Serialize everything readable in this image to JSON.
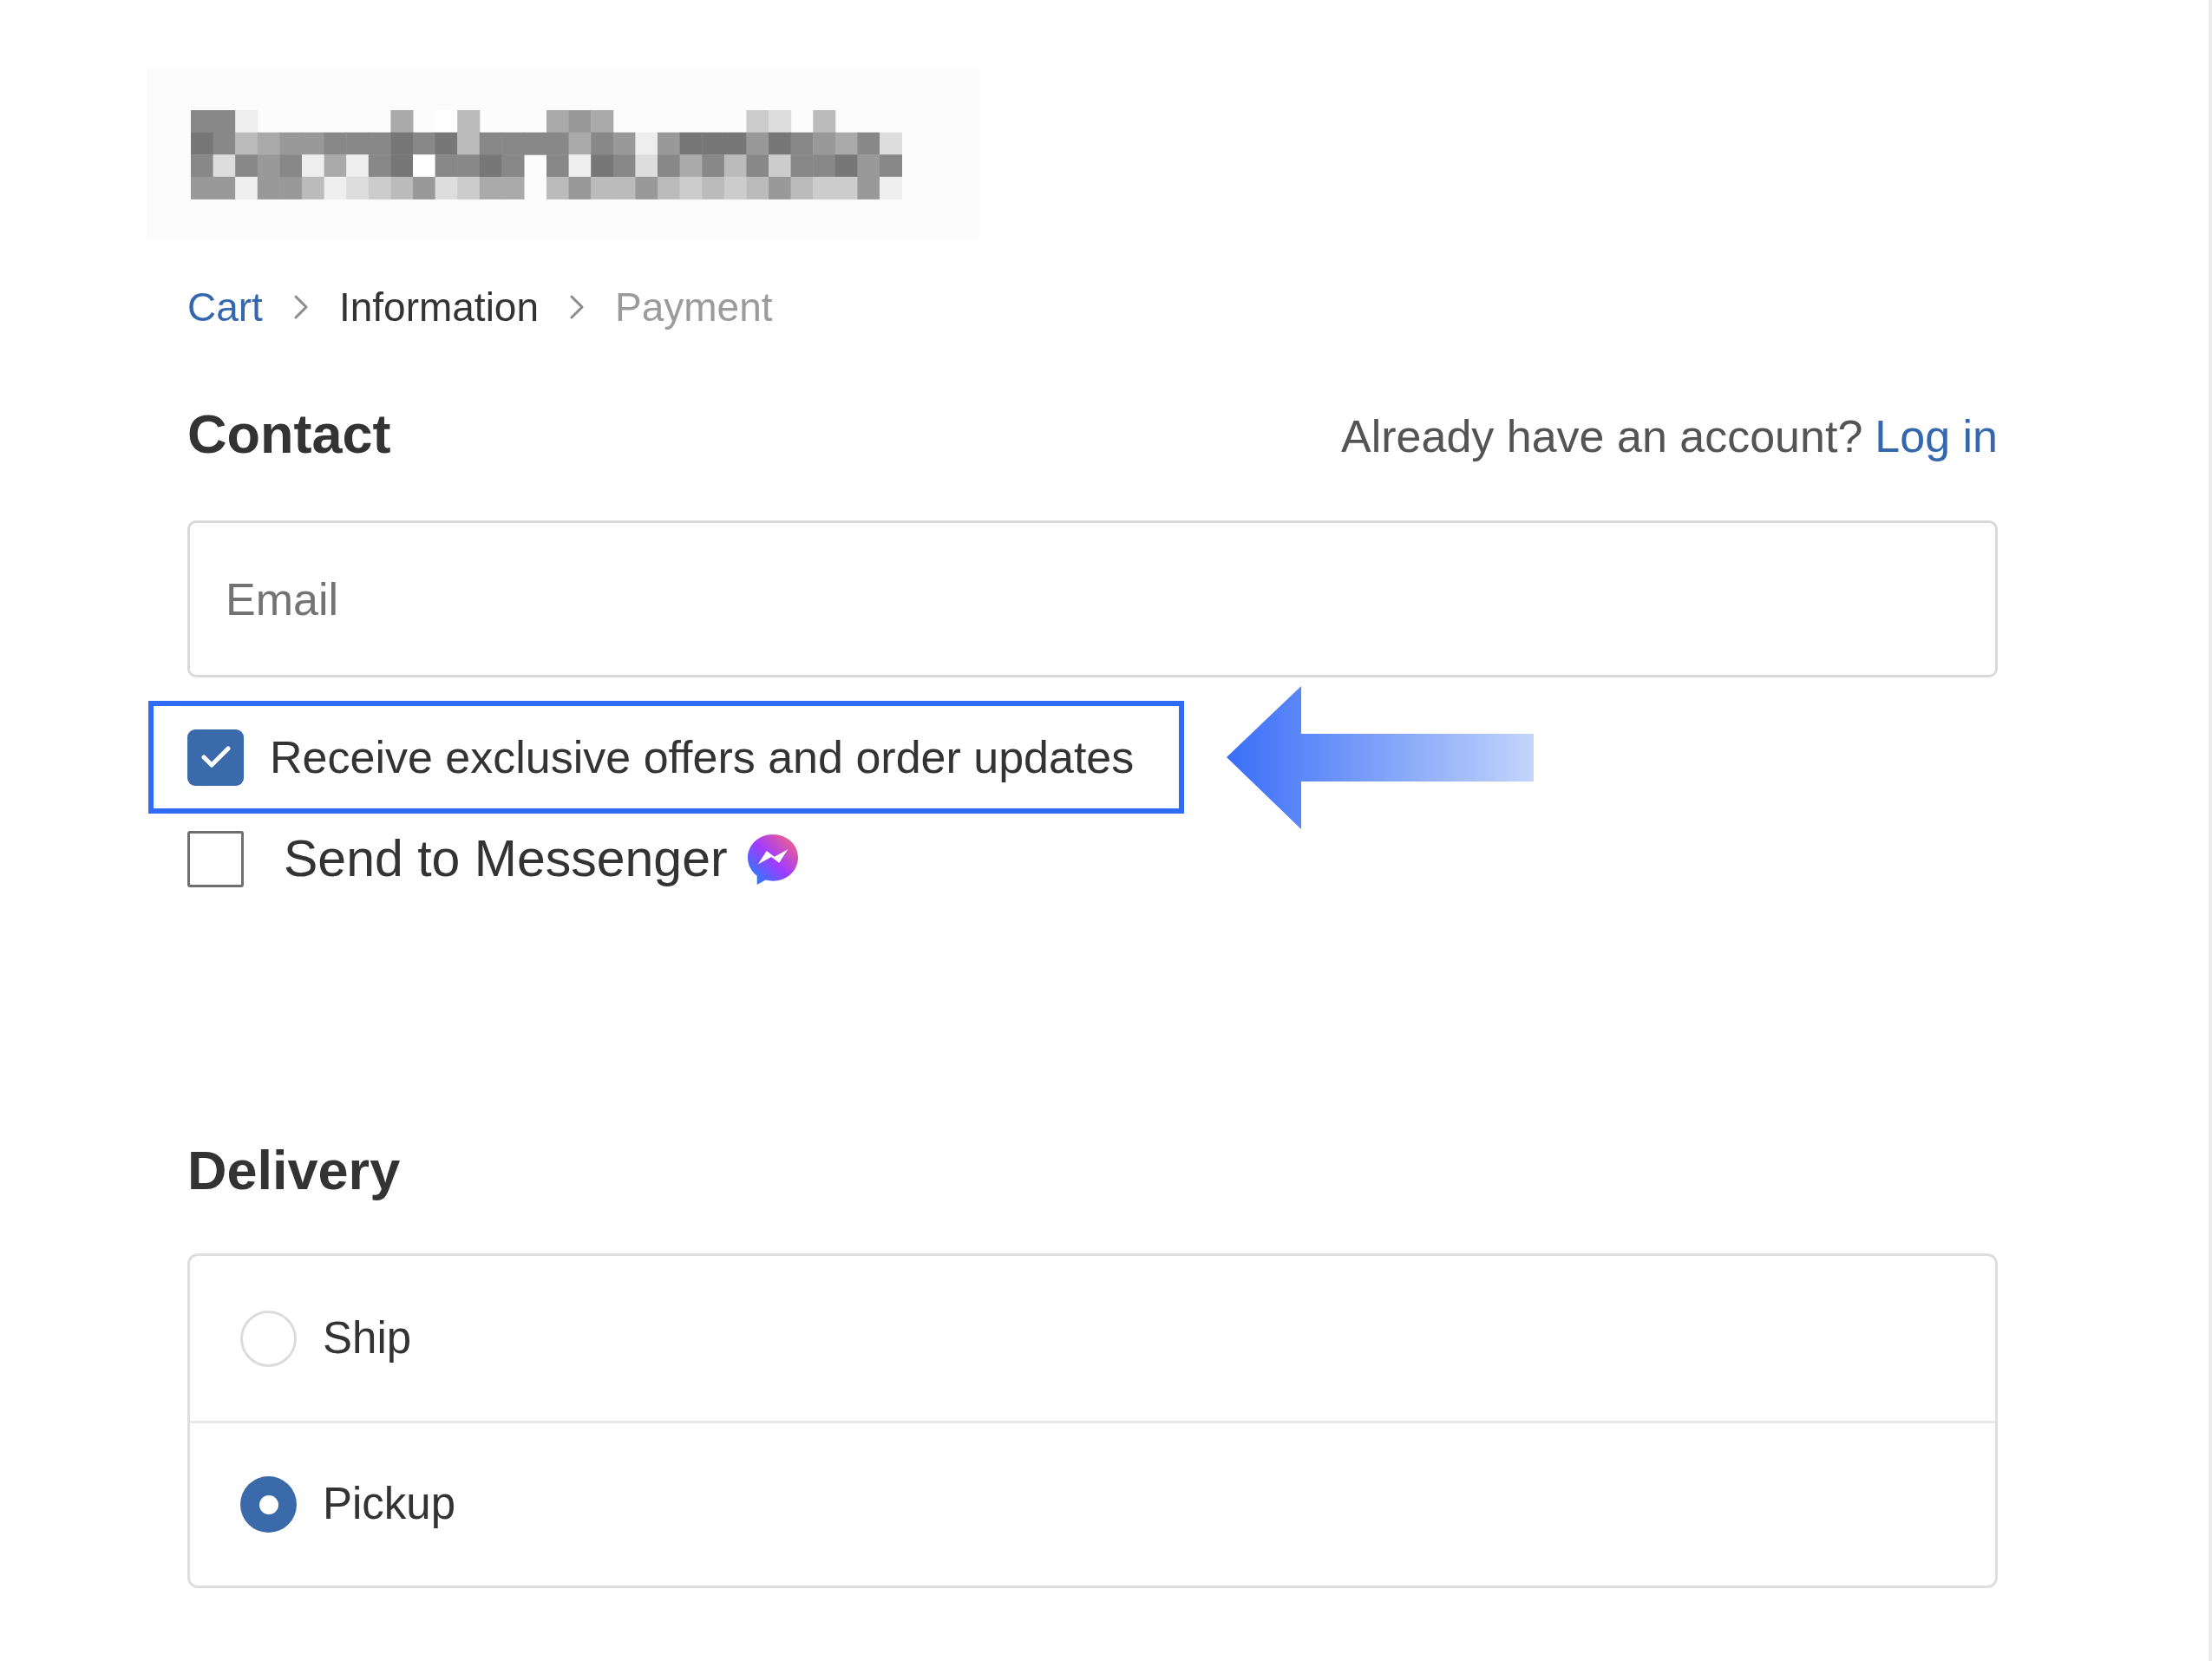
{
  "breadcrumb": [
    {
      "label": "Cart",
      "kind": "link"
    },
    {
      "label": "Information",
      "kind": "current"
    },
    {
      "label": "Payment",
      "kind": "upcoming"
    }
  ],
  "contact": {
    "title": "Contact",
    "login_prompt": "Already have an account?",
    "login_link": "Log in",
    "email_field": {
      "placeholder": "Email"
    },
    "options": [
      {
        "kind": "plain",
        "label": "Receive exclusive offers and order updates",
        "checked": true,
        "highlighted": true
      },
      {
        "kind": "messenger",
        "label": "Send to Messenger",
        "checked": false,
        "highlighted": false
      }
    ]
  },
  "delivery": {
    "title": "Delivery",
    "methods": [
      {
        "label": "Ship",
        "selected": false
      },
      {
        "label": "Pickup",
        "selected": true
      }
    ]
  }
}
